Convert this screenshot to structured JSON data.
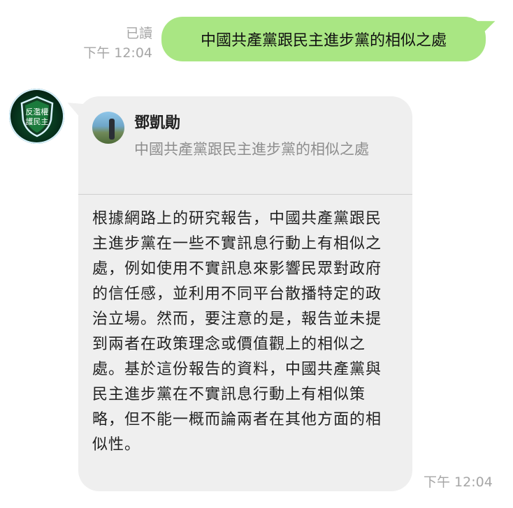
{
  "outgoing": {
    "read_label": "已讀",
    "time": "下午 12:04",
    "text": "中國共產黨跟民主進步黨的相似之處"
  },
  "incoming": {
    "avatar_text": [
      "反濫權",
      "護民主"
    ],
    "quote": {
      "name": "鄧凱勛",
      "text": "中國共產黨跟民主進步黨的相似之處"
    },
    "text": "根據網路上的研究報告，中國共產黨跟民主進步黨在一些不實訊息行動上有相似之處，例如使用不實訊息來影響民眾對政府的信任感，並利用不同平台散播特定的政治立場。然而，要注意的是，報告並未提到兩者在政策理念或價值觀上的相似之處。基於這份報告的資料，中國共產黨與民主進步黨在不實訊息行動上有相似策略，但不能一概而論兩者在其他方面的相似性。",
    "time": "下午 12:04"
  },
  "colors": {
    "outgoing_bubble": "#a9e683",
    "incoming_bubble": "#efefef",
    "meta_text": "#a6a6a6"
  }
}
